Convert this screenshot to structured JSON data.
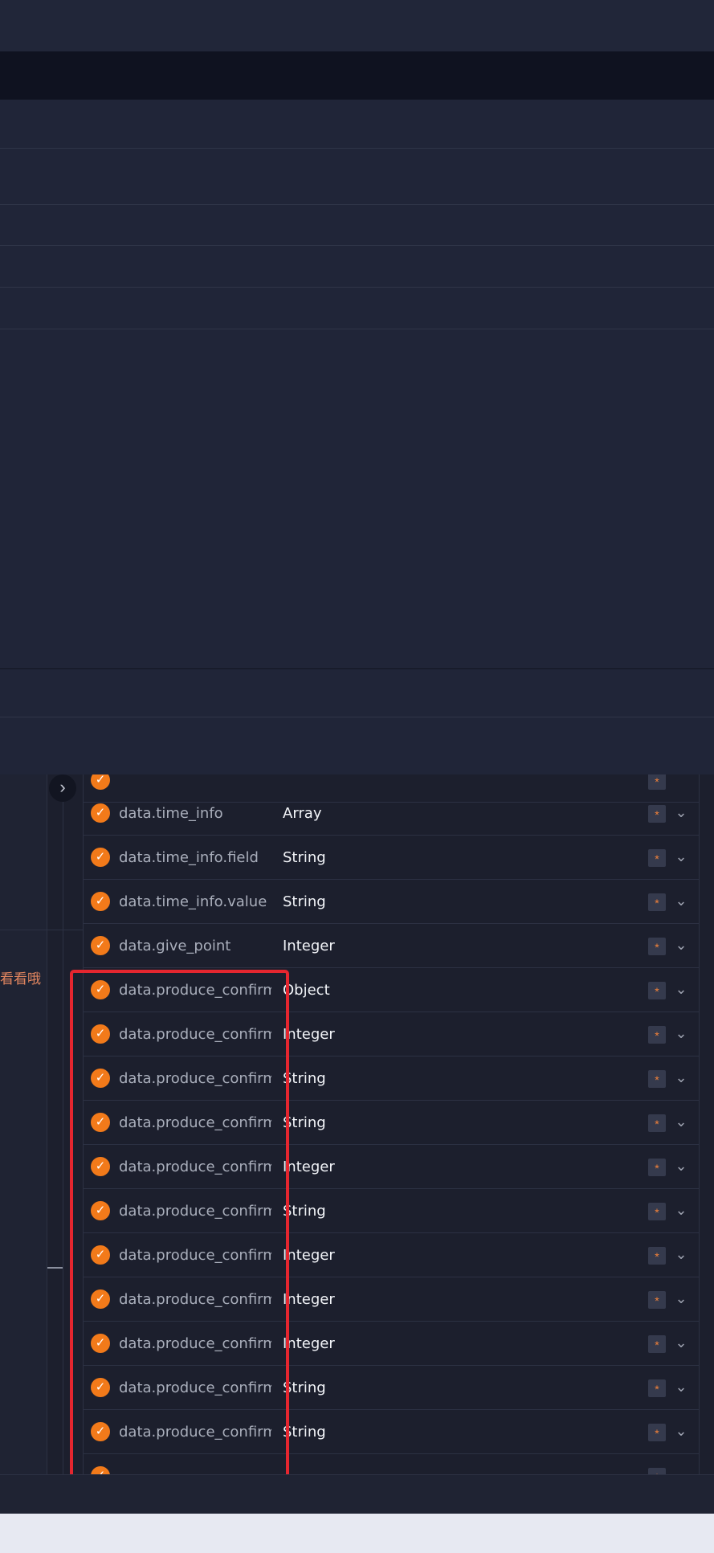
{
  "colors": {
    "background": "#202538",
    "panel": "#1c1f2d",
    "check_accent": "#f27a1a",
    "highlight_border": "#e5262f"
  },
  "side_note": "看看哦",
  "icons": {
    "expand": "chevron-right-icon",
    "check": "check-circle-icon",
    "expand_row": "chevron-down-icon"
  },
  "fields": [
    {
      "name": "data.time_info",
      "type": "Array",
      "required": "*"
    },
    {
      "name": "data.time_info.field",
      "type": "String",
      "required": "*"
    },
    {
      "name": "data.time_info.value",
      "type": "String",
      "required": "*"
    },
    {
      "name": "data.give_point",
      "type": "Integer",
      "required": "*"
    },
    {
      "name": "data.produce_confirm",
      "type": "Object",
      "required": "*"
    },
    {
      "name": "data.produce_confirm",
      "type": "Integer",
      "required": "*"
    },
    {
      "name": "data.produce_confirm",
      "type": "String",
      "required": "*"
    },
    {
      "name": "data.produce_confirm",
      "type": "String",
      "required": "*"
    },
    {
      "name": "data.produce_confirm",
      "type": "Integer",
      "required": "*"
    },
    {
      "name": "data.produce_confirm",
      "type": "String",
      "required": "*"
    },
    {
      "name": "data.produce_confirm",
      "type": "Integer",
      "required": "*"
    },
    {
      "name": "data.produce_confirm",
      "type": "Integer",
      "required": "*"
    },
    {
      "name": "data.produce_confirm",
      "type": "Integer",
      "required": "*"
    },
    {
      "name": "data.produce_confirm",
      "type": "String",
      "required": "*"
    },
    {
      "name": "data.produce_confirm",
      "type": "String",
      "required": "*"
    }
  ]
}
